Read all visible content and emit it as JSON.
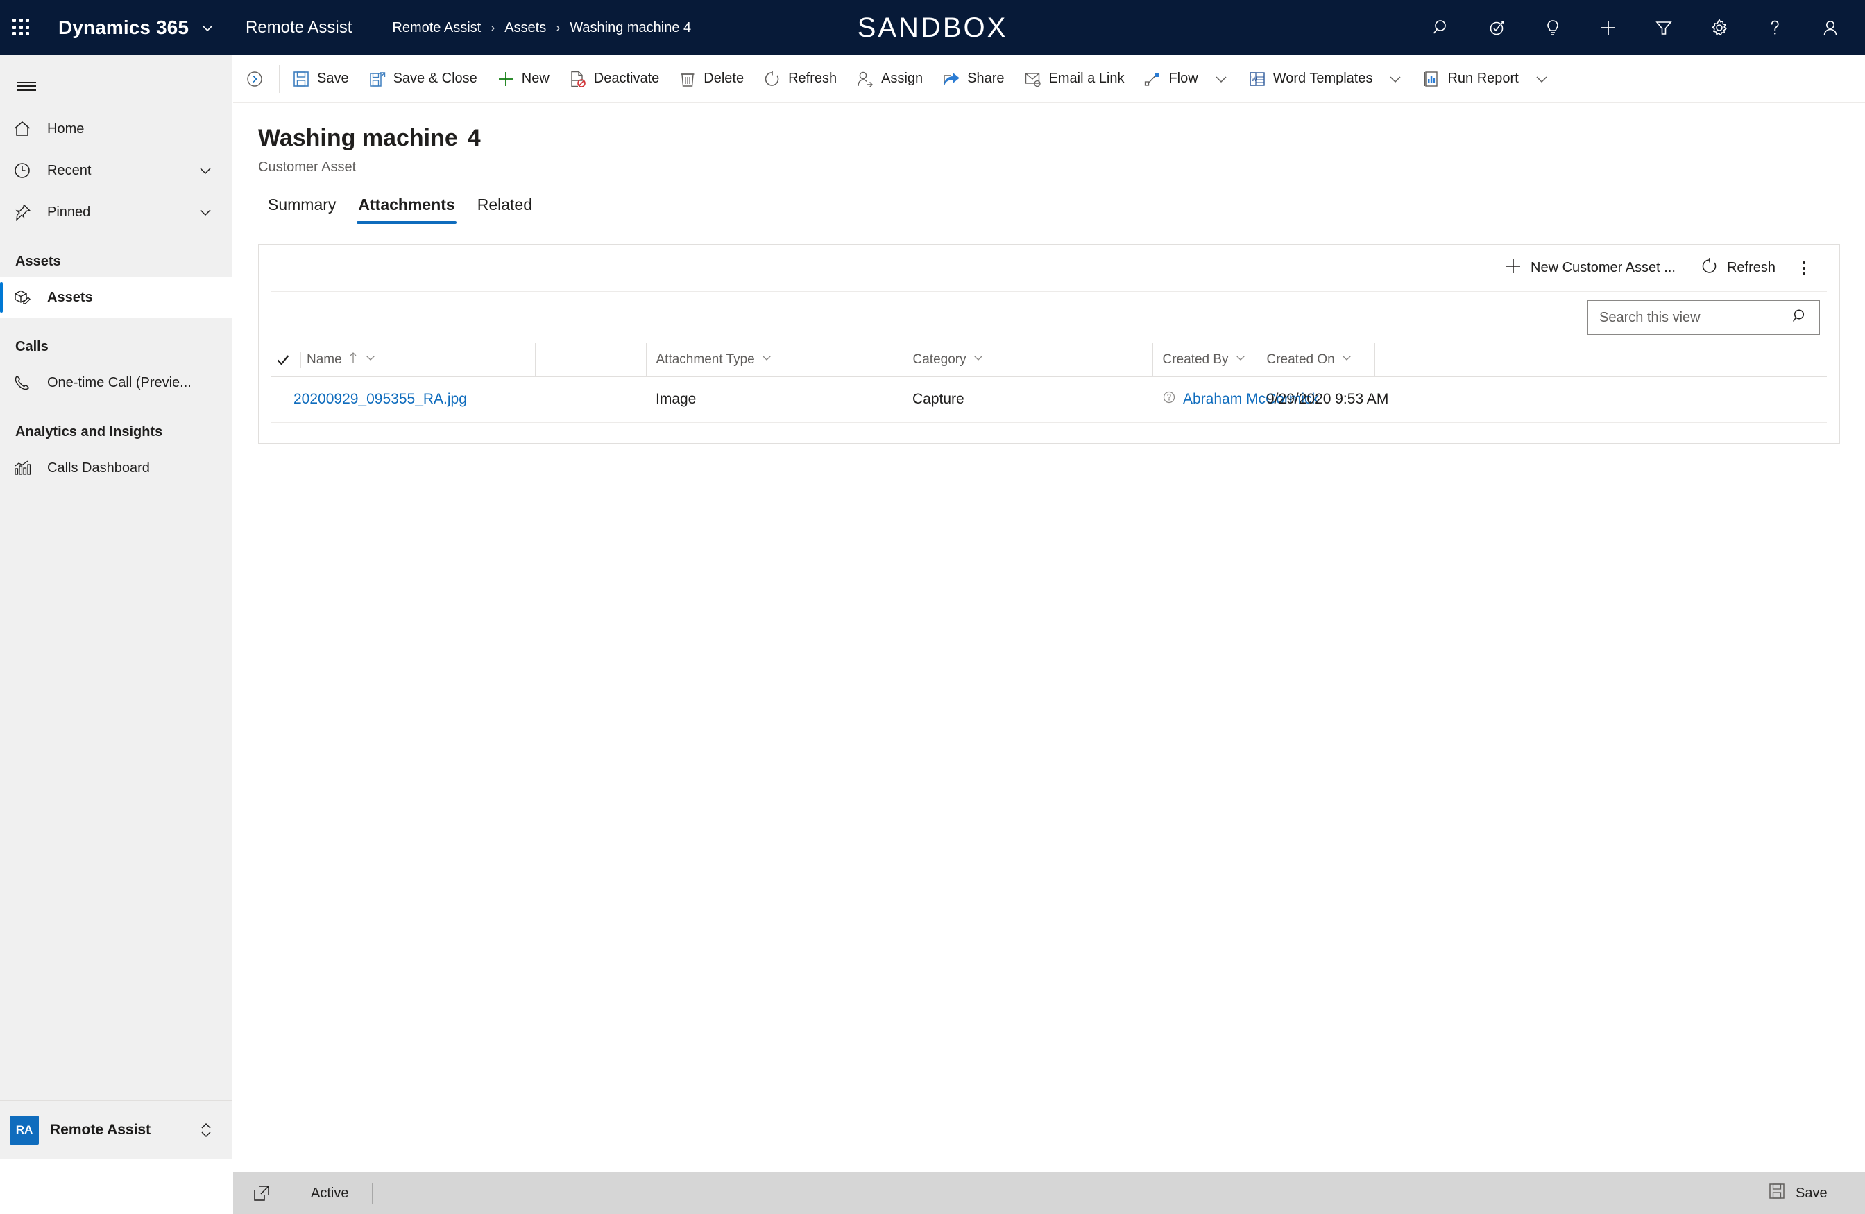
{
  "topbar": {
    "waffle_icon": "app-launcher-icon",
    "brand": "Dynamics 365",
    "brand_chevron_icon": "chevron-down-icon",
    "app_name": "Remote Assist",
    "environment_banner": "SANDBOX",
    "breadcrumb": [
      {
        "label": "Remote Assist"
      },
      {
        "label": "Assets"
      },
      {
        "label": "Washing machine 4"
      }
    ],
    "breadcrumb_separator": "›",
    "actions": [
      {
        "name": "search-icon",
        "title": "Search"
      },
      {
        "name": "diagnostics-icon",
        "title": "Diagnostics"
      },
      {
        "name": "lightbulb-icon",
        "title": "Tips"
      },
      {
        "name": "quick-create-plus-icon",
        "title": "New"
      },
      {
        "name": "filter-icon",
        "title": "Filter"
      },
      {
        "name": "gear-icon",
        "title": "Settings"
      },
      {
        "name": "help-question-icon",
        "title": "Help"
      },
      {
        "name": "user-account-icon",
        "title": "Account"
      }
    ]
  },
  "sidebar": {
    "hamburger_icon": "hamburger-menu-icon",
    "items": [
      {
        "label": "Home",
        "icon": "home-icon",
        "chevron": false,
        "selected": false
      },
      {
        "label": "Recent",
        "icon": "clock-icon",
        "chevron": true,
        "selected": false
      },
      {
        "label": "Pinned",
        "icon": "pin-icon",
        "chevron": true,
        "selected": false
      }
    ],
    "groups": [
      {
        "title": "Assets",
        "items": [
          {
            "label": "Assets",
            "icon": "asset-box-icon",
            "selected": true
          }
        ]
      },
      {
        "title": "Calls",
        "items": [
          {
            "label": "One-time Call (Previe...",
            "icon": "phone-icon",
            "selected": false
          }
        ]
      },
      {
        "title": "Analytics and Insights",
        "items": [
          {
            "label": "Calls Dashboard",
            "icon": "bar-chart-icon",
            "selected": false
          }
        ]
      }
    ],
    "footer": {
      "badge": "RA",
      "label": "Remote Assist",
      "chevron_icon": "chevron-up-down-icon"
    }
  },
  "commandbar": {
    "collapse_icon": "chevron-right-circle-icon",
    "buttons": [
      {
        "label": "Save",
        "icon": "save-disk-icon",
        "caret": false
      },
      {
        "label": "Save & Close",
        "icon": "save-and-close-icon",
        "caret": false
      },
      {
        "label": "New",
        "icon": "plus-icon",
        "caret": false
      },
      {
        "label": "Deactivate",
        "icon": "deactivate-icon",
        "caret": false
      },
      {
        "label": "Delete",
        "icon": "trash-icon",
        "caret": false
      },
      {
        "label": "Refresh",
        "icon": "refresh-icon",
        "caret": false
      },
      {
        "label": "Assign",
        "icon": "assign-person-icon",
        "caret": false
      },
      {
        "label": "Share",
        "icon": "share-icon",
        "caret": false
      },
      {
        "label": "Email a Link",
        "icon": "email-link-icon",
        "caret": false
      },
      {
        "label": "Flow",
        "icon": "flow-icon",
        "caret": true
      },
      {
        "label": "Word Templates",
        "icon": "word-doc-icon",
        "caret": true
      },
      {
        "label": "Run Report",
        "icon": "report-icon",
        "caret": true
      }
    ]
  },
  "form": {
    "record_title": "Washing machine",
    "record_number": "4",
    "entity_name": "Customer Asset",
    "tabs": [
      {
        "label": "Summary",
        "active": false
      },
      {
        "label": "Attachments",
        "active": true
      },
      {
        "label": "Related",
        "active": false
      }
    ]
  },
  "grid": {
    "toolbar": {
      "new_label": "New Customer Asset ...",
      "new_icon": "plus-icon",
      "refresh_label": "Refresh",
      "refresh_icon": "refresh-icon",
      "more_icon": "more-vertical-icon"
    },
    "search": {
      "placeholder": "Search this view",
      "value": "",
      "icon": "search-icon"
    },
    "columns": [
      {
        "label": "Name",
        "sorted": true,
        "sort_icon": "sort-ascending-arrow-icon"
      },
      {
        "label": "Attachment Type",
        "sorted": false
      },
      {
        "label": "Category",
        "sorted": false
      },
      {
        "label": "Created By",
        "sorted": false
      },
      {
        "label": "Created On",
        "sorted": false
      }
    ],
    "select_all_icon": "checkmark-icon",
    "column_menu_icon": "chevron-down-icon",
    "rows": [
      {
        "name": "20200929_095355_RA.jpg",
        "attachment_type": "Image",
        "category": "Capture",
        "created_by": "Abraham McCormick",
        "created_by_icon": "person-presence-icon",
        "created_on": "9/29/2020 9:53 AM"
      }
    ]
  },
  "footer": {
    "popout_icon": "pop-out-icon",
    "status": "Active",
    "save_label": "Save",
    "save_icon": "save-disk-icon"
  },
  "colors": {
    "topbar_bg": "#071A38",
    "accent": "#0f6cbd",
    "link": "#0f6cbd",
    "sidebar_bg": "#f0f0f0",
    "footer_bg": "#d6d6d6",
    "tab_underline": "#0f6cbd",
    "save_icon_blue": "#5b9bd5",
    "new_plus_green": "#107c10",
    "deactivate_red": "#d13438"
  }
}
